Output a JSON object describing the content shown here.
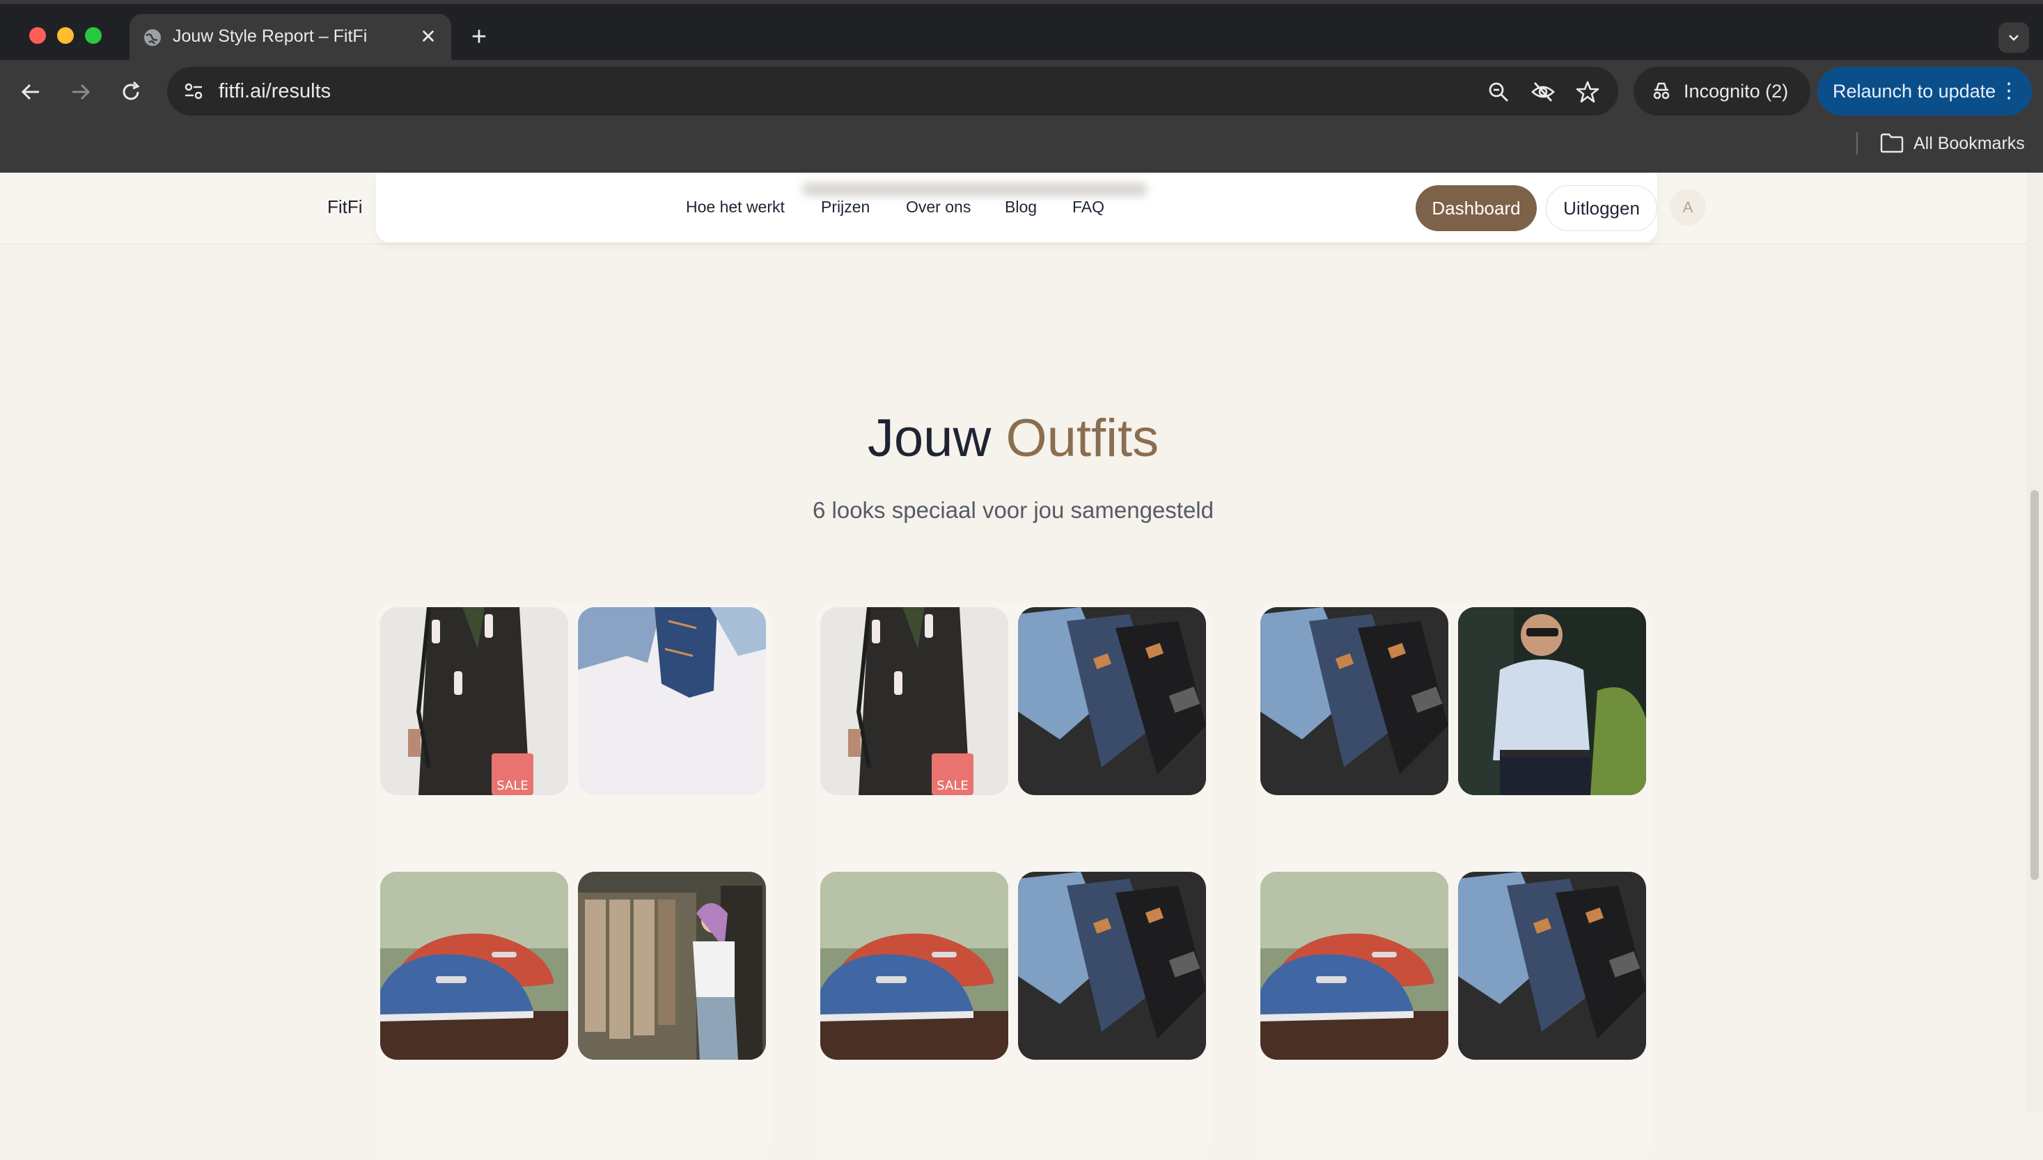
{
  "browser": {
    "tab_title": "Jouw Style Report – FitFi",
    "url": "fitfi.ai/results",
    "incognito_label": "Incognito (2)",
    "relaunch_label": "Relaunch to update",
    "bookmarks_label": "All Bookmarks"
  },
  "site": {
    "logo": "FitFi",
    "nav": [
      "Hoe het werkt",
      "Prijzen",
      "Over ons",
      "Blog",
      "FAQ"
    ],
    "dashboard_label": "Dashboard",
    "logout_label": "Uitloggen",
    "avatar_initial": "A",
    "accent_color": "#7d6148"
  },
  "main": {
    "heading_part1": "Jouw",
    "heading_part2": "Outfits",
    "subheading": "6 looks speciaal voor jou samengesteld"
  },
  "outfits": [
    {
      "items": [
        "coat-with-sale-bag-photo",
        "folded-jeans-photo"
      ]
    },
    {
      "items": [
        "coat-with-sale-bag-photo",
        "stacked-jeans-photo"
      ]
    },
    {
      "items": [
        "stacked-jeans-photo",
        "man-in-shirt-photo"
      ]
    },
    {
      "items": [
        "loafers-photo",
        "clothing-rack-shopper-photo"
      ]
    },
    {
      "items": [
        "loafers-photo",
        "stacked-jeans-photo"
      ]
    },
    {
      "items": [
        "loafers-photo",
        "stacked-jeans-photo"
      ]
    }
  ]
}
